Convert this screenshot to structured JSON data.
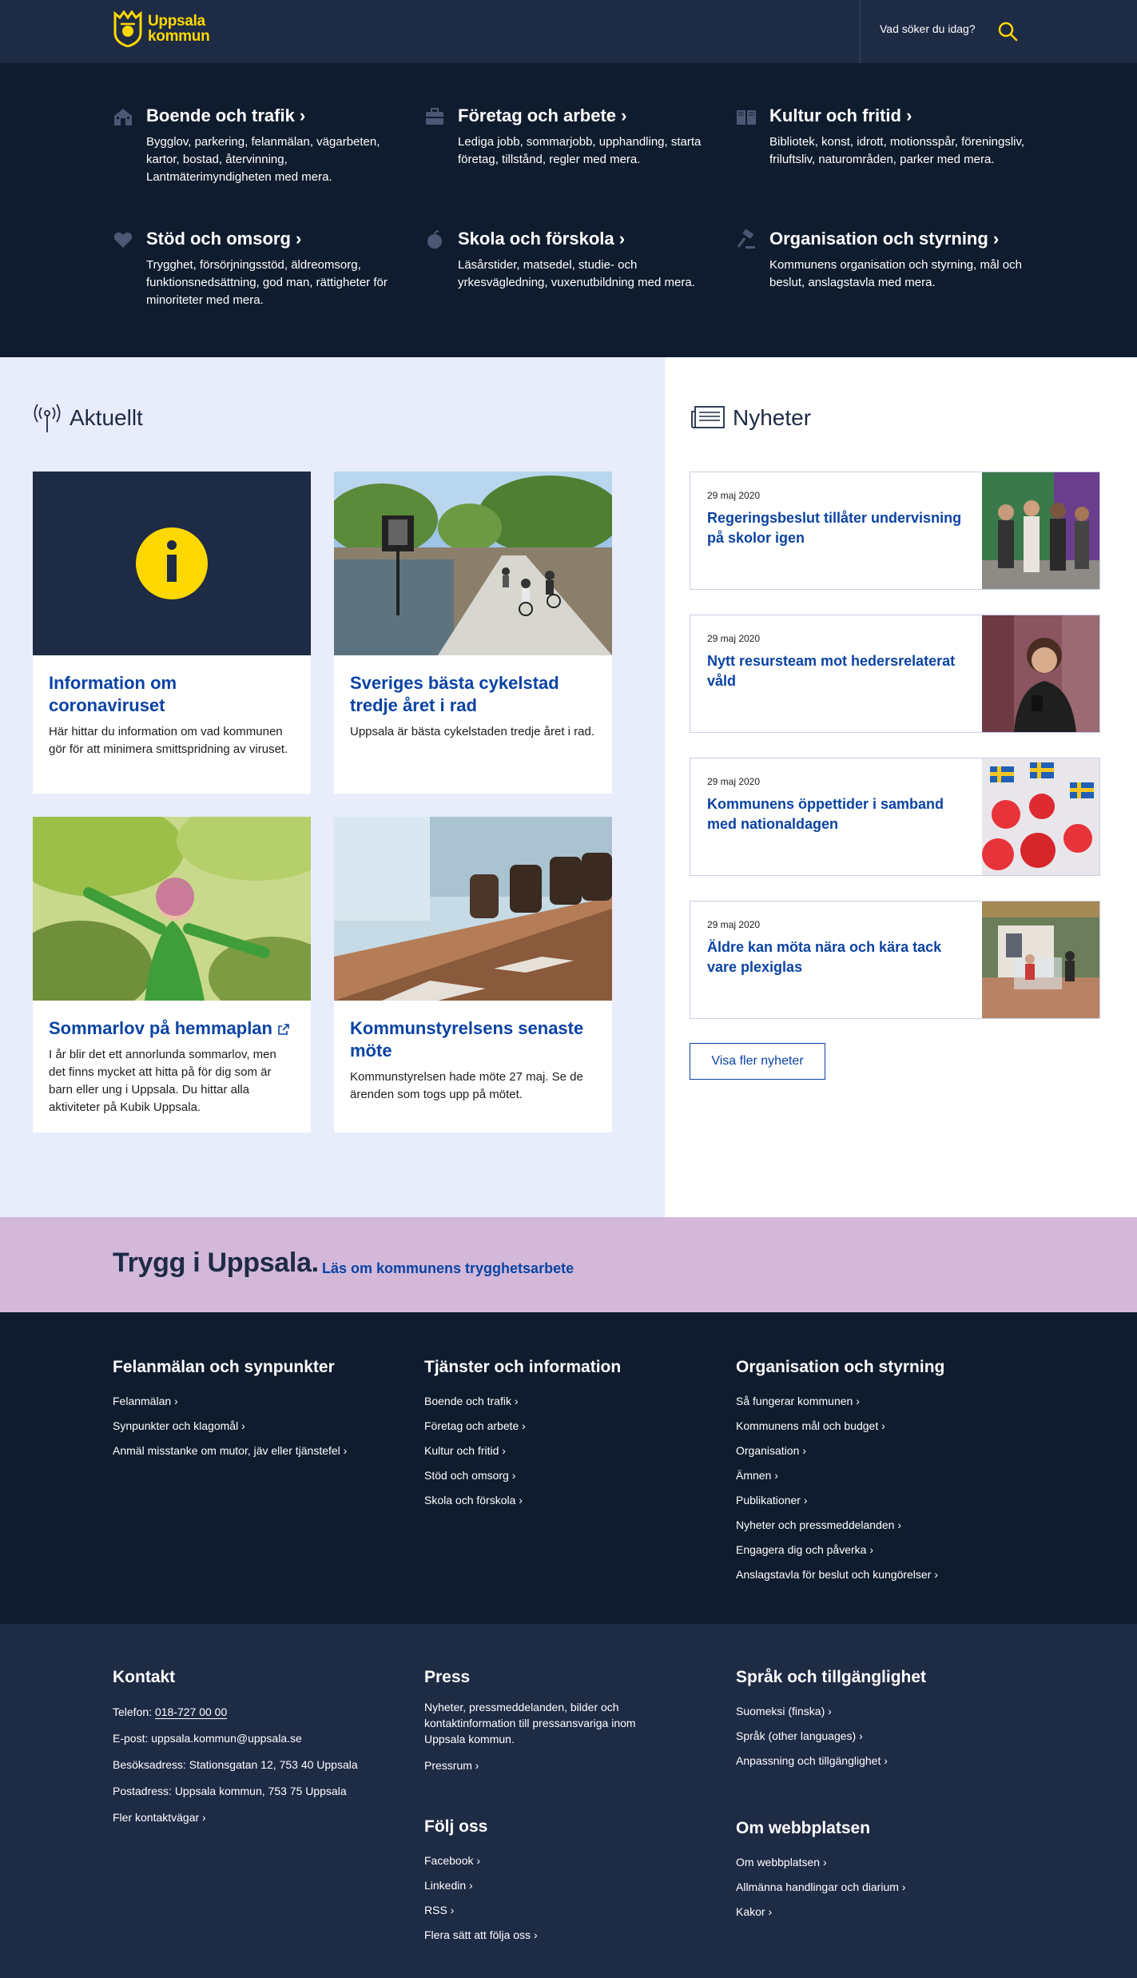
{
  "header": {
    "logo_line1": "Uppsala",
    "logo_line2": "kommun",
    "search_placeholder": "Vad söker du idag?"
  },
  "categories": [
    {
      "title": "Boende och trafik ›",
      "desc": "Bygglov, parkering, felanmälan, vägarbeten, kartor, bostad, återvinning, Lantmäterimyndigheten med mera.",
      "icon": "house-icon"
    },
    {
      "title": "Företag och arbete ›",
      "desc": "Lediga jobb, sommarjobb, upphandling, starta företag, tillstånd, regler med mera.",
      "icon": "briefcase-icon"
    },
    {
      "title": "Kultur och fritid ›",
      "desc": "Bibliotek, konst, idrott, motionsspår, föreningsliv, friluftsliv, naturområden, parker med mera.",
      "icon": "book-icon"
    },
    {
      "title": "Stöd och omsorg ›",
      "desc": "Trygghet, försörjningsstöd, äldreomsorg, funktionsnedsättning, god man, rättigheter för minoriteter med mera.",
      "icon": "heart-icon"
    },
    {
      "title": "Skola och förskola ›",
      "desc": "Läsårstider, matsedel, studie- och yrkesvägledning, vuxenutbildning med mera.",
      "icon": "apple-icon"
    },
    {
      "title": "Organisation och styrning ›",
      "desc": "Kommunens organisation och styrning, mål och beslut, anslagstavla med mera.",
      "icon": "gavel-icon"
    }
  ],
  "aktuellt": {
    "heading": "Aktuellt",
    "cards": [
      {
        "title": "Information om coronaviruset",
        "text": "Här hittar du information om vad kommunen gör för att minimera smittspridning av viruset."
      },
      {
        "title": "Sveriges bästa cykelstad tredje året i rad",
        "text": "Uppsala är bästa cykelstaden tredje året i rad."
      },
      {
        "title": "Sommarlov på hemmaplan",
        "text": "I år blir det ett annorlunda sommarlov, men det finns mycket att hitta på för dig som är barn eller ung i Uppsala. Du hittar alla aktiviteter på Kubik Uppsala."
      },
      {
        "title": "Kommunstyrelsens senaste möte",
        "text": "Kommunstyrelsen hade möte 27 maj. Se de ärenden som togs upp på mötet."
      }
    ]
  },
  "nyheter": {
    "heading": "Nyheter",
    "items": [
      {
        "date": "29 maj 2020",
        "title": "Regeringsbeslut tillåter undervisning på skolor igen"
      },
      {
        "date": "29 maj 2020",
        "title": "Nytt resursteam mot hedersrelaterat våld"
      },
      {
        "date": "29 maj 2020",
        "title": "Kommunens öppettider i samband med nationaldagen"
      },
      {
        "date": "29 maj 2020",
        "title": "Äldre kan möta nära och kära tack vare plexiglas"
      }
    ],
    "more_label": "Visa fler nyheter"
  },
  "trygg": {
    "title": "Trygg i Uppsala.",
    "link": "Läs om kommunens trygghetsarbete"
  },
  "footer_links": [
    {
      "heading": "Felanmälan och synpunkter",
      "links": [
        "Felanmälan ›",
        "Synpunkter och klagomål ›",
        "Anmäl misstanke om mutor, jäv eller tjänstefel ›"
      ]
    },
    {
      "heading": "Tjänster och information",
      "links": [
        "Boende och trafik ›",
        "Företag och arbete ›",
        "Kultur och fritid ›",
        "Stöd och omsorg ›",
        "Skola och förskola ›"
      ]
    },
    {
      "heading": "Organisation och styrning",
      "links": [
        "Så fungerar kommunen ›",
        "Kommunens mål och budget ›",
        "Organisation ›",
        "Ämnen ›",
        "Publikationer ›",
        "Nyheter och pressmeddelanden ›",
        "Engagera dig och påverka ›",
        "Anslagstavla för beslut och kungörelser ›"
      ]
    }
  ],
  "footer_info": {
    "contact": {
      "heading": "Kontakt",
      "phone_label": "Telefon: ",
      "phone": "018-727 00 00",
      "email": "E-post: uppsala.kommun@uppsala.se",
      "visit": "Besöksadress: Stationsgatan 12, 753 40 Uppsala",
      "post": "Postadress: Uppsala kommun, 753 75 Uppsala",
      "more": "Fler kontaktvägar ›"
    },
    "press": {
      "heading": "Press",
      "text": "Nyheter, pressmeddelanden, bilder och kontaktinformation till pressansvariga inom Uppsala kommun.",
      "link": "Pressrum ›"
    },
    "follow": {
      "heading": "Följ oss",
      "links": [
        "Facebook ›",
        "Linkedin ›",
        "RSS ›",
        "Flera sätt att följa oss ›"
      ]
    },
    "language": {
      "heading": "Språk och tillgänglighet",
      "links": [
        "Suomeksi (finska) ›",
        "Språk (other languages) ›",
        "Anpassning och tillgänglighet ›"
      ]
    },
    "about": {
      "heading": "Om webbplatsen",
      "links": [
        "Om webbplatsen ›",
        "Allmänna handlingar och diarium ›",
        "Kakor ›"
      ]
    }
  },
  "colors": {
    "header_bg": "#1e2b45",
    "nav_bg": "#0f1c2e",
    "brand_yellow": "#ffd800",
    "link_blue": "#0b43a4",
    "aktuellt_bg": "#e8ecfb",
    "trygg_bg": "#d3b8da"
  }
}
